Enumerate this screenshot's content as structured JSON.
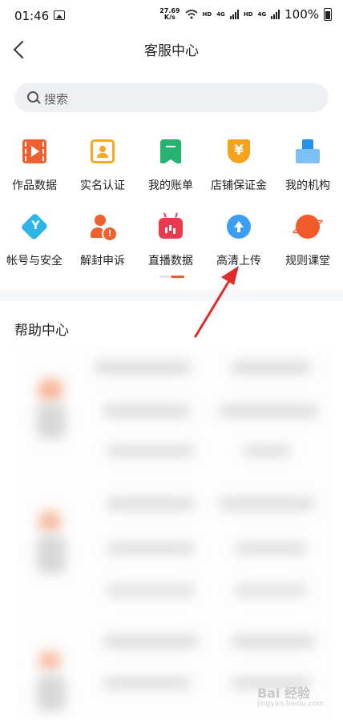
{
  "status_bar": {
    "time": "01:46",
    "speed_value": "27.69",
    "speed_unit": "K/s",
    "hd1": "HD",
    "net1": "4G",
    "hd2": "HD",
    "net2": "4G",
    "battery": "100%"
  },
  "nav": {
    "title": "客服中心"
  },
  "search": {
    "placeholder": "搜索"
  },
  "services": [
    {
      "label": "作品数据",
      "icon": "video-data-icon"
    },
    {
      "label": "实名认证",
      "icon": "id-verify-icon"
    },
    {
      "label": "我的账单",
      "icon": "bill-icon"
    },
    {
      "label": "店铺保证金",
      "icon": "yen-deposit-icon",
      "glyph": "¥"
    },
    {
      "label": "我的机构",
      "icon": "organization-icon"
    },
    {
      "label": "帐号与安全",
      "icon": "account-security-icon"
    },
    {
      "label": "解封申诉",
      "icon": "unban-appeal-icon"
    },
    {
      "label": "直播数据",
      "icon": "live-data-icon"
    },
    {
      "label": "高清上传",
      "icon": "hd-upload-icon"
    },
    {
      "label": "规则课堂",
      "icon": "rules-class-icon"
    }
  ],
  "help": {
    "title": "帮助中心"
  },
  "watermark": {
    "main": "Bai 经验",
    "sub": "jingyan.baidu.com"
  },
  "colors": {
    "accent": "#f0602e",
    "annotation_arrow": "#e02b2b"
  }
}
